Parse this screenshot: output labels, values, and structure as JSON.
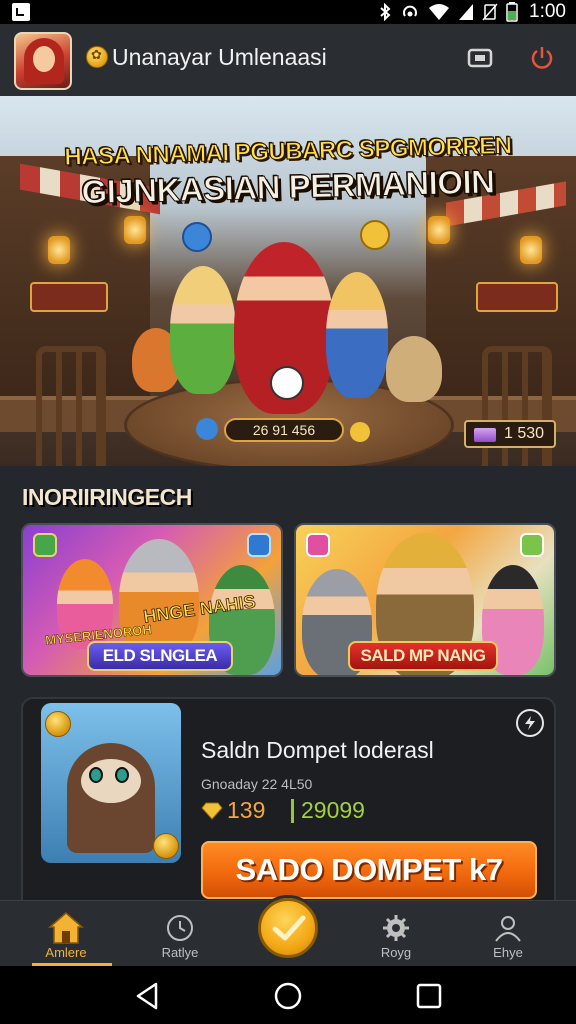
{
  "status_bar": {
    "time": "1:00"
  },
  "header": {
    "title": "Unanayar Umlenaasi"
  },
  "hero": {
    "title_line1": "HASA NNAMAI PGUBARC SPGMORREN",
    "title_line2": "GIJNKASIAN PERMANIOIN",
    "score_pill": "26 91 456",
    "ticket_value": "1 530"
  },
  "section": {
    "title": "INORIIRINGECH"
  },
  "cards": [
    {
      "label": "ELD SLNGLEA",
      "small_text": "MYSERIENOROH",
      "big_text": "HNGE NAHIS"
    },
    {
      "label": "SALD MP NANG"
    }
  ],
  "wallet": {
    "title": "Saldn Dompet loderasl",
    "subtitle": "Gnoaday 22 4L50",
    "value_gold": "139",
    "value_green": "29099",
    "button_label": "SADO DOMPET k7"
  },
  "bottom_nav": {
    "items": [
      {
        "label": "Amlere",
        "icon": "home-icon",
        "active": true
      },
      {
        "label": "Ratlye",
        "icon": "clock-icon",
        "active": false
      },
      {
        "label": "",
        "icon": "check-icon",
        "active": false
      },
      {
        "label": "Royg",
        "icon": "gear-icon",
        "active": false
      },
      {
        "label": "Ehye",
        "icon": "person-icon",
        "active": false
      }
    ]
  },
  "colors": {
    "accent": "#f3b233",
    "button_orange": "#f26a0e",
    "gold_text": "#f4a641",
    "green_text": "#a2d13d",
    "background": "#24272b"
  }
}
